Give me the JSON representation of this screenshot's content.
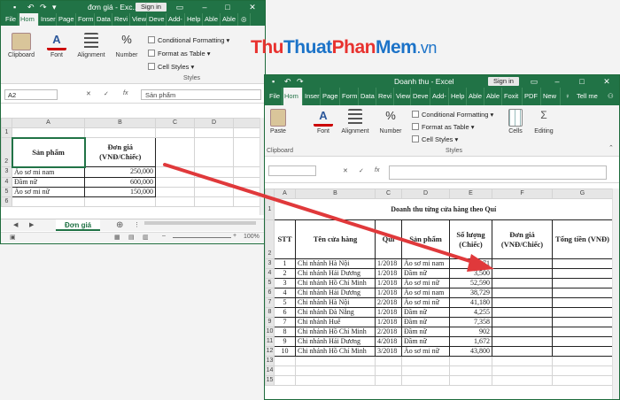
{
  "left_window": {
    "title": "đơn giá - Exc...",
    "sign_in": "Sign in",
    "tabs": [
      "File",
      "Hom",
      "Inser",
      "Page",
      "Form",
      "Data",
      "Revi",
      "View",
      "Deve",
      "Add-",
      "Help",
      "Able",
      "Able"
    ],
    "ribbon": {
      "clipboard": "Clipboard",
      "font": "Font",
      "alignment": "Alignment",
      "number": "Number",
      "conditional_formatting": "Conditional Formatting ▾",
      "format_as_table": "Format as Table ▾",
      "cell_styles": "Cell Styles ▾",
      "styles": "Styles"
    },
    "name_box": "A2",
    "formula": "Sản phẩm",
    "cols": [
      "A",
      "B",
      "C",
      "D"
    ],
    "rows": [
      {
        "n": "1"
      },
      {
        "n": "2",
        "a": "Sản phẩm",
        "b": "Đơn giá (VNĐ/Chiếc)"
      },
      {
        "n": "3",
        "a": "Áo sơ mi nam",
        "b": "250,000"
      },
      {
        "n": "4",
        "a": "Đầm nữ",
        "b": "600,000"
      },
      {
        "n": "5",
        "a": "Áo sơ mi nữ",
        "b": "150,000"
      },
      {
        "n": "6"
      }
    ],
    "sheet_tab": "Đơn giá",
    "zoom": "100%"
  },
  "watermark": {
    "p1": "Thu",
    "p2": "Thuat",
    "p3": "Phan",
    "p4": "Mem",
    "p5": ".vn"
  },
  "right_window": {
    "title": "Doanh thu - Excel",
    "sign_in": "Sign in",
    "tabs": [
      "File",
      "Hom",
      "Inser",
      "Page",
      "Form",
      "Data",
      "Revi",
      "View",
      "Deve",
      "Add-",
      "Help",
      "Able",
      "Able",
      "Foxit",
      "PDF",
      "New"
    ],
    "tell_me": "Tell me",
    "ribbon": {
      "paste": "Paste",
      "clipboard": "Clipboard",
      "font": "Font",
      "alignment": "Alignment",
      "number": "Number",
      "conditional_formatting": "Conditional Formatting ▾",
      "format_as_table": "Format as Table ▾",
      "cell_styles": "Cell Styles ▾",
      "styles": "Styles",
      "cells": "Cells",
      "editing": "Editing"
    },
    "cols": [
      "A",
      "B",
      "C",
      "D",
      "E",
      "F",
      "G"
    ],
    "sheet_title_row": "1",
    "sheet_title": "Doanh thu từng cửa hàng theo Quí",
    "header_row": "2",
    "headers": [
      "STT",
      "Tên cửa hàng",
      "Quí",
      "Sản phẩm",
      "Số lượng (Chiếc)",
      "Đơn giá (VNĐ/Chiếc)",
      "Tổng tiền (VNĐ)"
    ],
    "rows": [
      {
        "n": "3",
        "stt": "1",
        "store": "Chi nhánh Hà Nội",
        "q": "1/2018",
        "product": "Áo sơ mi nam",
        "qty": "52,871"
      },
      {
        "n": "4",
        "stt": "2",
        "store": "Chi nhánh Hải Dương",
        "q": "1/2018",
        "product": "Đầm nữ",
        "qty": "3,500"
      },
      {
        "n": "5",
        "stt": "3",
        "store": "Chi nhánh Hồ Chí Minh",
        "q": "1/2018",
        "product": "Áo sơ mi nữ",
        "qty": "52,590"
      },
      {
        "n": "6",
        "stt": "4",
        "store": "Chi nhánh Hải Dương",
        "q": "1/2018",
        "product": "Áo sơ mi nam",
        "qty": "38,729"
      },
      {
        "n": "7",
        "stt": "5",
        "store": "Chi nhánh Hà Nội",
        "q": "2/2018",
        "product": "Áo sơ mi nữ",
        "qty": "41,180"
      },
      {
        "n": "8",
        "stt": "6",
        "store": "Chi nhánh Đà Nẵng",
        "q": "1/2018",
        "product": "Đầm nữ",
        "qty": "4,255"
      },
      {
        "n": "9",
        "stt": "7",
        "store": "Chi nhánh Huế",
        "q": "1/2018",
        "product": "Đầm nữ",
        "qty": "7,358"
      },
      {
        "n": "10",
        "stt": "8",
        "store": "Chi nhánh Hồ Chí Minh",
        "q": "2/2018",
        "product": "Đầm nữ",
        "qty": "902"
      },
      {
        "n": "11",
        "stt": "9",
        "store": "Chi nhánh Hải Dương",
        "q": "4/2018",
        "product": "Đầm nữ",
        "qty": "1,672"
      },
      {
        "n": "12",
        "stt": "10",
        "store": "Chi nhánh Hồ Chí Minh",
        "q": "3/2018",
        "product": "Áo sơ mi nữ",
        "qty": "43,800"
      },
      {
        "n": "13"
      },
      {
        "n": "14"
      },
      {
        "n": "15"
      }
    ]
  }
}
